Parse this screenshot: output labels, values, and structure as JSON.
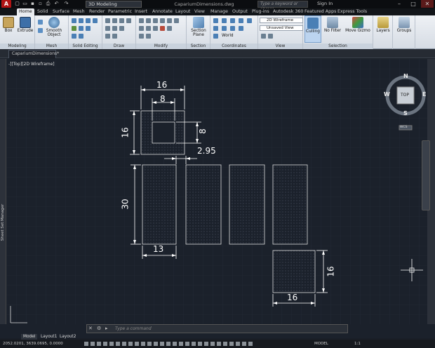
{
  "titlebar": {
    "workspace": "3D Modeling",
    "document_title": "CapariumDimensions.dwg",
    "search_placeholder": "Type a keyword or phrase",
    "signin": "Sign In",
    "app_letter": "A"
  },
  "ribbon_tabs": [
    "Home",
    "Solid",
    "Surface",
    "Mesh",
    "Render",
    "Parametric",
    "Insert",
    "Annotate",
    "Layout",
    "View",
    "Manage",
    "Output",
    "Plug-ins",
    "Autodesk 360",
    "Featured Apps",
    "Express Tools"
  ],
  "panels": {
    "modeling": {
      "label": "Modeling",
      "box": "Box",
      "extrude": "Extrude"
    },
    "mesh": {
      "label": "Mesh",
      "smooth": "Smooth Object"
    },
    "solid_editing": {
      "label": "Solid Editing"
    },
    "draw": {
      "label": "Draw"
    },
    "modify": {
      "label": "Modify"
    },
    "section": {
      "label": "Section",
      "section_plane": "Section Plane"
    },
    "coordinates": {
      "label": "Coordinates",
      "world": "World"
    },
    "view": {
      "label": "View",
      "visual_style": "2D Wireframe",
      "saved_view": "Unsaved View"
    },
    "selection": {
      "label": "Selection",
      "culling": "Culling",
      "no_filter": "No Filter",
      "move_gizmo": "Move Gizmo"
    },
    "layers": {
      "label": "Layers"
    },
    "groups": {
      "label": "Groups"
    }
  },
  "document_tab": "CapariumDimensions*",
  "viewport_label": "-][Top][2D Wireframe]",
  "sheet_set_manager": "Sheet Set Manager",
  "viewcube": {
    "top": "TOP",
    "n": "N",
    "s": "S",
    "e": "E",
    "w": "W",
    "wcs": "WCS"
  },
  "dimensions": {
    "top_width": "16",
    "inner_width": "8",
    "top_height": "16",
    "inner_height": "8",
    "gap": "2.95",
    "panel_height": "30",
    "panel_width": "13",
    "bottom_height": "16",
    "bottom_width": "16"
  },
  "layout_tabs": [
    "Model",
    "Layout1",
    "Layout2"
  ],
  "command_placeholder": "Type a command",
  "status": {
    "coords": "2052.0201, 3639.0695, 0.0000",
    "model": "MODEL",
    "scale": "1:1"
  },
  "colors": {
    "canvas": "#1b212b",
    "dim": "#ffffff",
    "ribbon": "#e4e8ed"
  }
}
